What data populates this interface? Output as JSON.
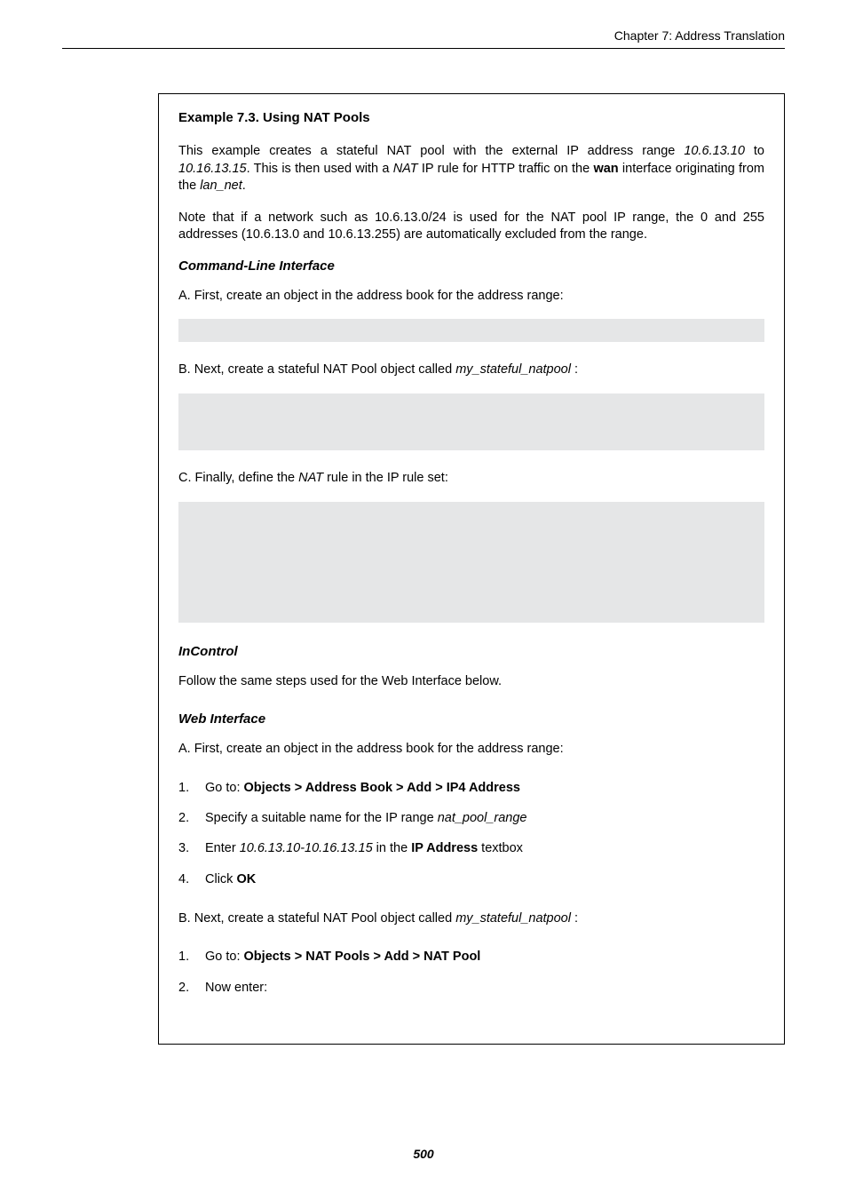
{
  "chapter_header": "Chapter 7: Address Translation",
  "example": {
    "title": "Example 7.3. Using NAT Pools",
    "para1_a": "This example creates a stateful NAT pool with the external IP address range ",
    "para1_ip1": "10.6.13.10",
    "para1_b": " to ",
    "para1_ip2": "10.16.13.15",
    "para1_c": ". This is then used with a ",
    "para1_nat": "NAT",
    "para1_d": " IP rule for HTTP traffic on the ",
    "para1_wan": "wan",
    "para1_e": " interface originating from the ",
    "para1_lan": "lan_net",
    "para1_f": ".",
    "para2": "Note that if a network such as 10.6.13.0/24 is used for the NAT pool IP range, the 0 and 255 addresses (10.6.13.0 and 10.6.13.255) are automatically excluded from the range.",
    "cli_heading": "Command-Line Interface",
    "stepA": "A. First, create an object in the address book for the address range:",
    "stepB_a": "B. Next, create a stateful NAT Pool object called ",
    "stepB_name": "my_stateful_natpool ",
    "stepB_b": ":",
    "stepC_a": "C. Finally, define the ",
    "stepC_nat": "NAT",
    "stepC_b": " rule in the IP rule set:",
    "incontrol_heading": "InControl",
    "incontrol_text": "Follow the same steps used for the Web Interface below.",
    "web_heading": "Web Interface",
    "webA": "A. First, create an object in the address book for the address range:",
    "webA_steps": {
      "s1_a": "Go to: ",
      "s1_b": "Objects > Address Book > Add > IP4 Address",
      "s2_a": "Specify a suitable name for the IP range ",
      "s2_b": "nat_pool_range",
      "s3_a": "Enter ",
      "s3_b": "10.6.13.10-10.16.13.15",
      "s3_c": " in the ",
      "s3_d": "IP Address",
      "s3_e": " textbox",
      "s4_a": "Click ",
      "s4_b": "OK"
    },
    "webB_a": "B. Next, create a stateful NAT Pool object called ",
    "webB_name": "my_stateful_natpool ",
    "webB_b": ":",
    "webB_steps": {
      "s1_a": "Go to: ",
      "s1_b": "Objects > NAT Pools > Add > NAT Pool",
      "s2": "Now enter:"
    }
  },
  "page_number": "500"
}
